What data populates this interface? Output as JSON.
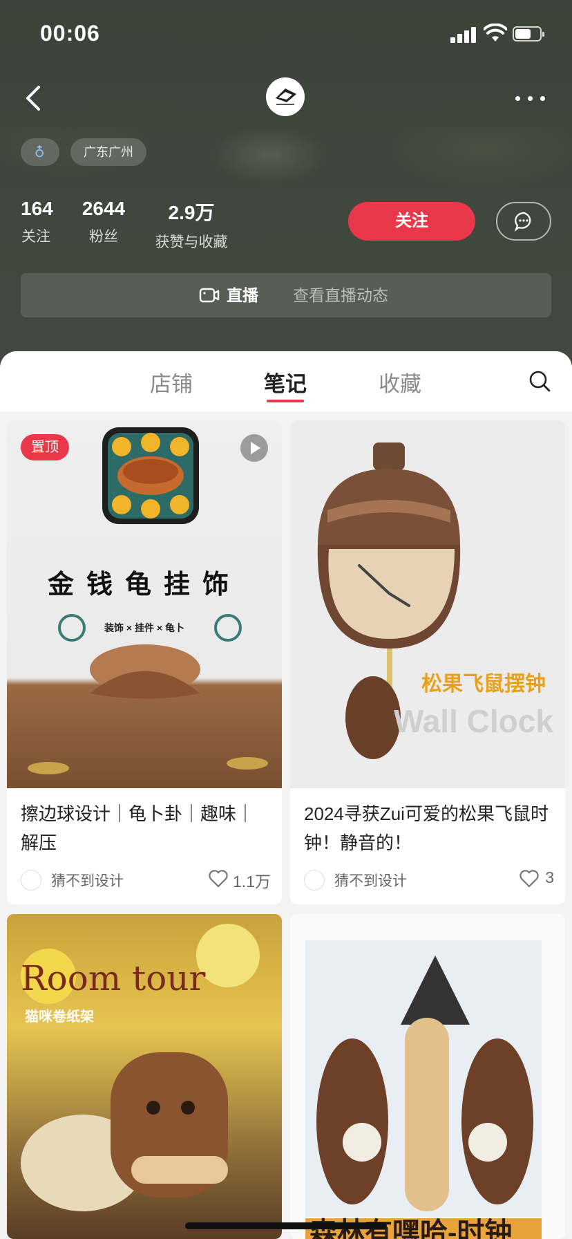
{
  "status_bar": {
    "time": "00:06"
  },
  "profile": {
    "tags": {
      "gender_icon": "male-icon",
      "location": "广东广州"
    },
    "stats": [
      {
        "value": "164",
        "label": "关注"
      },
      {
        "value": "2644",
        "label": "粉丝"
      },
      {
        "value": "2.9万",
        "label": "获赞与收藏"
      }
    ],
    "follow_label": "关注",
    "live": {
      "title": "直播",
      "subtitle": "查看直播动态"
    }
  },
  "tabs": [
    {
      "label": "店铺",
      "active": false
    },
    {
      "label": "笔记",
      "active": true
    },
    {
      "label": "收藏",
      "active": false
    }
  ],
  "colors": {
    "accent": "#e8384a",
    "header_bg": "#3f463b",
    "page_bg": "#f3f3f3"
  },
  "notes": [
    {
      "pinned_label": "置顶",
      "is_video": true,
      "image_text": {
        "headline": "金钱龟挂饰",
        "sub": "装饰 × 挂件 × 龟卜"
      },
      "title": "擦边球设计｜龟卜卦｜趣味｜解压",
      "author": "猜不到设计",
      "likes": "1.1万"
    },
    {
      "image_text": {
        "headline": "松果飞鼠摆钟",
        "sub": "Wall Clock"
      },
      "title": "2024寻获Zui可爱的松果飞鼠时钟！静音的！",
      "author": "猜不到设计",
      "likes": "3"
    },
    {
      "image_text": {
        "headline": "Room tour",
        "sub": "猫咪卷纸架"
      }
    },
    {
      "image_text": {
        "headline": "森林有嘿哈-时钟"
      }
    }
  ],
  "icons": [
    "back-icon",
    "more-icon",
    "message-icon",
    "live-camera-icon",
    "search-icon",
    "heart-icon",
    "play-icon"
  ]
}
